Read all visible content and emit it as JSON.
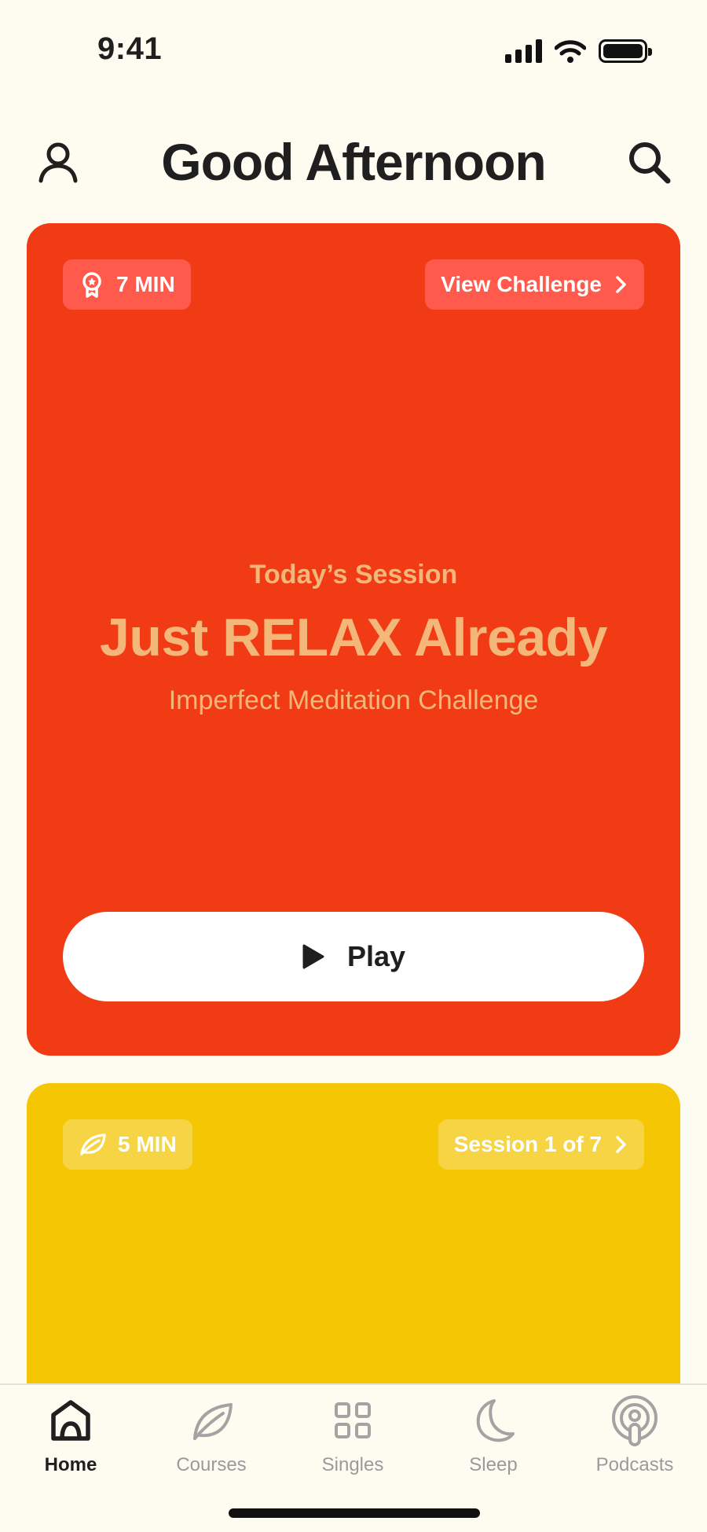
{
  "status_bar": {
    "time": "9:41",
    "icons": [
      "signal-icon",
      "wifi-icon",
      "battery-icon"
    ]
  },
  "header": {
    "title": "Good Afternoon",
    "left_icon": "profile-icon",
    "right_icon": "search-icon"
  },
  "featured_card": {
    "background_color": "#F03B14",
    "duration_badge": {
      "icon": "award-icon",
      "label": "7 MIN"
    },
    "link_button": {
      "label": "View Challenge",
      "icon": "chevron-right-icon"
    },
    "eyebrow": "Today’s Session",
    "title": "Just RELAX Already",
    "subtitle": "Imperfect Meditation Challenge",
    "play_button": {
      "icon": "play-icon",
      "label": "Play"
    }
  },
  "second_card": {
    "background_color": "#F4C604",
    "duration_badge": {
      "icon": "leaf-icon",
      "label": "5 MIN"
    },
    "link_button": {
      "label": "Session 1 of 7",
      "icon": "chevron-right-icon"
    }
  },
  "tab_bar": {
    "tabs": [
      {
        "label": "Home",
        "icon": "home-icon",
        "active": true
      },
      {
        "label": "Courses",
        "icon": "leaf-icon",
        "active": false
      },
      {
        "label": "Singles",
        "icon": "grid-icon",
        "active": false
      },
      {
        "label": "Sleep",
        "icon": "moon-icon",
        "active": false
      },
      {
        "label": "Podcasts",
        "icon": "podcast-icon",
        "active": false
      }
    ]
  },
  "colors": {
    "background": "#FEFCF1",
    "accent_text": "#F4B77A",
    "active_tab": "#1F1F1F",
    "inactive_tab": "#9A9A9A"
  }
}
